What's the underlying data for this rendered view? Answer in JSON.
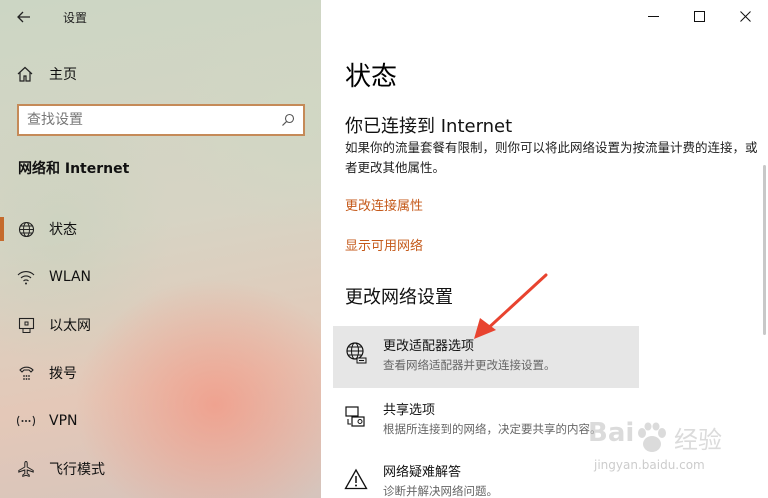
{
  "window": {
    "app_title": "设置",
    "controls": {
      "minimize": "—",
      "maximize": "☐",
      "close": "✕"
    }
  },
  "sidebar": {
    "home_label": "主页",
    "search_placeholder": "查找设置",
    "section_title": "网络和 Internet",
    "items": [
      {
        "label": "状态",
        "icon": "globe-icon",
        "active": true
      },
      {
        "label": "WLAN",
        "icon": "wifi-icon",
        "active": false
      },
      {
        "label": "以太网",
        "icon": "ethernet-icon",
        "active": false
      },
      {
        "label": "拨号",
        "icon": "dialup-icon",
        "active": false
      },
      {
        "label": "VPN",
        "icon": "vpn-icon",
        "active": false
      },
      {
        "label": "飞行模式",
        "icon": "airplane-icon",
        "active": false
      }
    ]
  },
  "main": {
    "title": "状态",
    "connection_title": "你已连接到 Internet",
    "connection_desc": "如果你的流量套餐有限制，则你可以将此网络设置为按流量计费的连接，或者更改其他属性。",
    "link_change_props": "更改连接属性",
    "link_show_networks": "显示可用网络",
    "section_title": "更改网络设置",
    "options": [
      {
        "title": "更改适配器选项",
        "desc": "查看网络适配器并更改连接设置。",
        "icon": "adapter-globe-icon"
      },
      {
        "title": "共享选项",
        "desc": "根据所连接到的网络，决定要共享的内容。",
        "icon": "sharing-icon"
      },
      {
        "title": "网络疑难解答",
        "desc": "诊断并解决网络问题。",
        "icon": "warning-icon"
      }
    ]
  },
  "watermark": {
    "brand": "Bai",
    "brand_cn": "经验",
    "url": "jingyan.baidu.com"
  },
  "colors": {
    "accent": "#c55a1b",
    "active_bar": "#c56a2c",
    "annotation_arrow": "#e8432f",
    "search_border": "#c58a58"
  }
}
